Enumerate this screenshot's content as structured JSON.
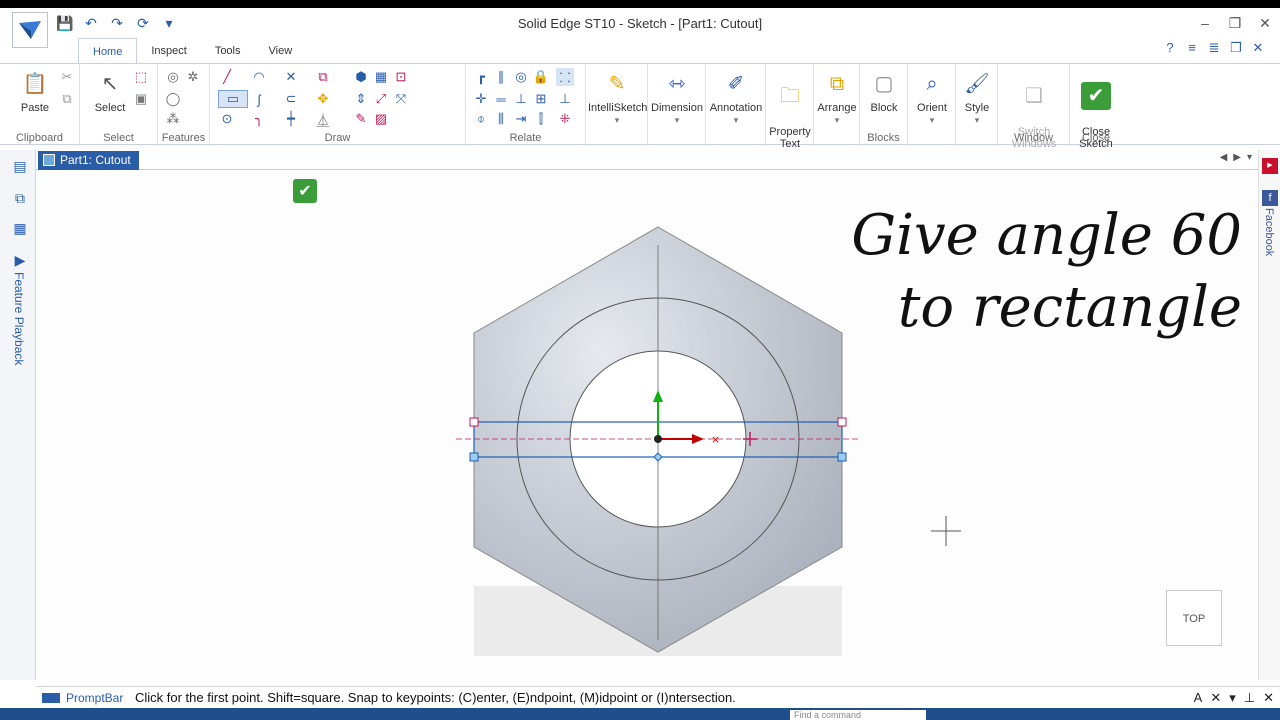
{
  "window": {
    "title": "Solid Edge ST10 - Sketch - [Part1: Cutout]"
  },
  "tabs": [
    "Home",
    "Inspect",
    "Tools",
    "View"
  ],
  "ribbon": {
    "clipboard": {
      "paste": "Paste",
      "label": "Clipboard"
    },
    "select": {
      "select": "Select",
      "label": "Select"
    },
    "features": {
      "label": "Features"
    },
    "draw": {
      "label": "Draw"
    },
    "relate": {
      "label": "Relate"
    },
    "intellisketch": "IntelliSketch",
    "dimension": "Dimension",
    "annotation": "Annotation",
    "property_text": "Property\nText",
    "arrange": "Arrange",
    "blocks": {
      "block": "Block",
      "label": "Blocks"
    },
    "orient": "Orient",
    "style": "Style",
    "window": {
      "switch": "Switch\nWindows",
      "label": "Window"
    },
    "close": {
      "close_sketch": "Close\nSketch",
      "label": "Close"
    }
  },
  "document_tab": "Part1: Cutout",
  "left_panel": {
    "feature_playback": "Feature Playback"
  },
  "right_panel": {
    "facebook": "Facebook"
  },
  "overlay": {
    "line1": "Give angle 60",
    "line2": "to rectangle"
  },
  "view_cube": "TOP",
  "promptbar": {
    "label": "PromptBar",
    "text": "Click for the first point.  Shift=square.  Snap to keypoints: (C)enter, (E)ndpoint, (M)idpoint or (I)ntersection."
  },
  "command_search": {
    "placeholder": "Find a command"
  },
  "colors": {
    "accent": "#2a5da8",
    "sketch_line": "#1a5fb4",
    "handle": "#c2185b",
    "x_axis": "#c00000",
    "y_axis": "#10b010"
  }
}
